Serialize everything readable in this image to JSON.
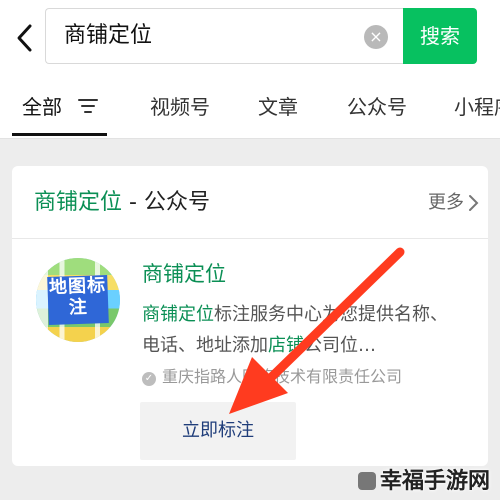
{
  "search": {
    "value": "商铺定位",
    "button": "搜索"
  },
  "tabs": [
    {
      "label": "全部"
    },
    {
      "label": "视频号"
    },
    {
      "label": "文章"
    },
    {
      "label": "公众号"
    },
    {
      "label": "小程序"
    }
  ],
  "section": {
    "title_green": "商铺定位",
    "title_rest": " - 公众号",
    "more": "更多"
  },
  "result": {
    "logo_text": "地图标注",
    "name": "商铺定位",
    "desc_green": "商铺定位",
    "desc_mid": "标注服务中心为您提供名称、电话、地址添加",
    "desc_green2": "店铺",
    "desc_tail": "公司位…",
    "company": "重庆指路人网络技术有限责任公司",
    "action": "立即标注"
  },
  "watermark": "幸福手游网",
  "colors": {
    "accent": "#07c160",
    "green_text": "#0b8f55",
    "arrow": "#ff3b1f"
  }
}
